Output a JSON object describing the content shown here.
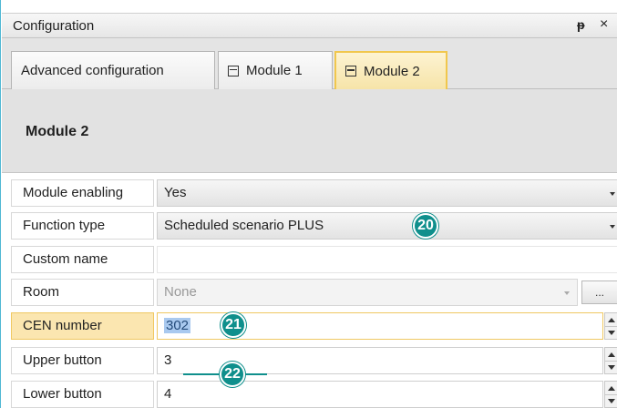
{
  "window": {
    "title": "Configuration",
    "pin_glyph": "ᵽ",
    "close_glyph": "×"
  },
  "tabs": [
    {
      "label": "Advanced configuration",
      "icon": "none",
      "active": false
    },
    {
      "label": "Module 1",
      "icon": "module-icon",
      "active": false
    },
    {
      "label": "Module 2",
      "icon": "module-icon",
      "active": true
    }
  ],
  "section": {
    "title": "Module 2"
  },
  "properties": {
    "module_enabling": {
      "label": "Module enabling",
      "value": "Yes"
    },
    "function_type": {
      "label": "Function type",
      "value": "Scheduled scenario PLUS"
    },
    "custom_name": {
      "label": "Custom name",
      "value": ""
    },
    "room": {
      "label": "Room",
      "value": "None",
      "button": "..."
    },
    "cen_number": {
      "label": "CEN number",
      "value": "302"
    },
    "upper_button": {
      "label": "Upper button",
      "value": "3"
    },
    "lower_button": {
      "label": "Lower button",
      "value": "4"
    }
  },
  "callouts": [
    "20",
    "21",
    "22"
  ],
  "colors": {
    "accent_highlight": "#fbe6b0",
    "callout": "#0f8f8c",
    "frame": "#4fb8d4"
  }
}
